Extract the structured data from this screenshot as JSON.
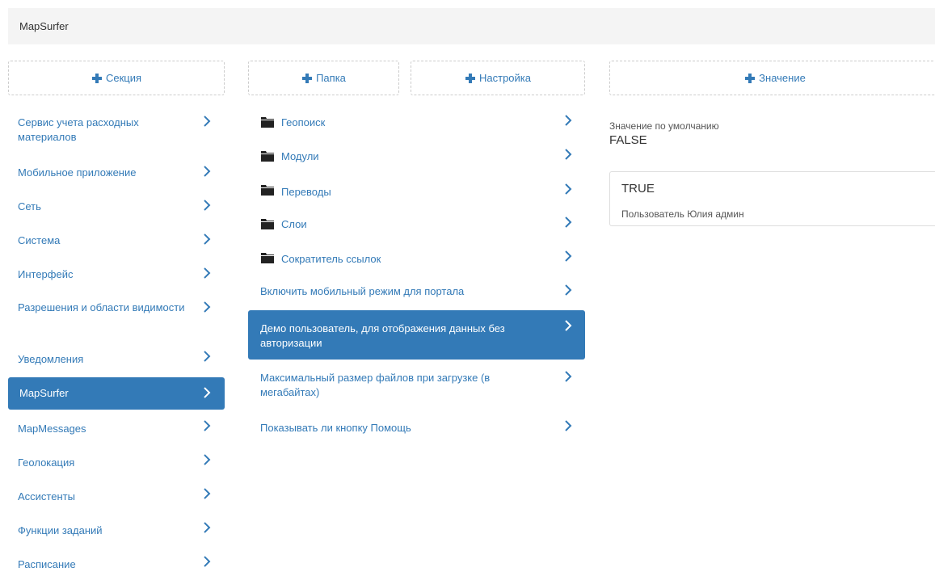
{
  "app": {
    "title": "MapSurfer"
  },
  "sections": {
    "add_label": "Секция",
    "items": [
      {
        "label": "Сервис учета расходных материалов",
        "line1": "Сервис учета расходных",
        "line2": "материалов",
        "active": false
      },
      {
        "label": "Мобильное приложение",
        "active": false
      },
      {
        "label": "Сеть",
        "active": false
      },
      {
        "label": "Система",
        "active": false
      },
      {
        "label": "Интерфейс",
        "active": false
      },
      {
        "label": "Разрешения и области видимости",
        "active": false
      },
      {
        "label": "Уведомления",
        "active": false
      },
      {
        "label": "MapSurfer",
        "active": true
      },
      {
        "label": "MapMessages",
        "active": false
      },
      {
        "label": "Геолокация",
        "active": false
      },
      {
        "label": "Ассистенты",
        "active": false
      },
      {
        "label": "Функции заданий",
        "active": false
      },
      {
        "label": "Расписание",
        "active": false
      }
    ]
  },
  "settings": {
    "add_folder_label": "Папка",
    "add_setting_label": "Настройка",
    "folders": [
      {
        "label": "Геопоиск",
        "icon": "folder-icon"
      },
      {
        "label": "Модули",
        "icon": "folder-icon"
      },
      {
        "label": "Переводы",
        "icon": "folder-icon"
      },
      {
        "label": "Слои",
        "icon": "folder-icon"
      },
      {
        "label": "Сократитель ссылок",
        "icon": "folder-icon"
      }
    ],
    "items": [
      {
        "label": "Включить мобильный режим для портала",
        "active": false
      },
      {
        "label": "Демо пользователь, для отображения данных без авторизации",
        "line1": "Демо пользователь, для отображения данных без",
        "line2": "авторизации",
        "active": true
      },
      {
        "label": "Максимальный размер файлов при загрузке (в мегабайтах)",
        "line1": "Максимальный размер файлов при загрузке (в",
        "line2": "мегабайтах)",
        "active": false
      },
      {
        "label": "Показывать ли кнопку Помощь",
        "active": false
      }
    ]
  },
  "values": {
    "add_label": "Значение",
    "default_label": "Значение по умолчанию",
    "default_value": "FALSE",
    "entries": [
      {
        "value": "TRUE",
        "user": "Пользователь Юлия админ"
      }
    ]
  },
  "colors": {
    "accent": "#337ab7",
    "link": "#337ab7",
    "topbar_bg": "#f4f4f4",
    "border": "#cccccc"
  }
}
